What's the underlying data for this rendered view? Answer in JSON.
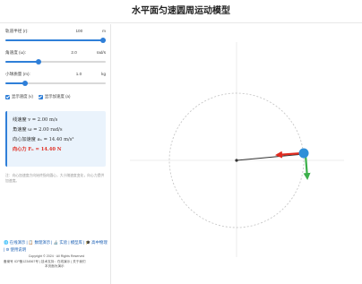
{
  "title": "水平面匀速圆周运动模型",
  "controls": [
    {
      "label": "轨道半径 (r):",
      "value": "100",
      "unit": "m",
      "fraction": 1.0
    },
    {
      "label": "角速度 (ω):",
      "value": "2.0",
      "unit": "rad/s",
      "fraction": 0.33
    },
    {
      "label": "小球质量 (m):",
      "value": "1.0",
      "unit": "kg",
      "fraction": 0.2
    }
  ],
  "checkboxes": [
    {
      "label": "显示速度 (v)",
      "checked": true
    },
    {
      "label": "显示加速度 (a)",
      "checked": true
    }
  ],
  "info": {
    "linear_velocity": "线速度   v = 2.00 m/s",
    "angular_velocity": "角速度   ω = 2.00 rad/s",
    "centripetal_accel": "向心加速度  aₙ = 14.40 m/s²",
    "centripetal_force": "向心力   Fₙ = 14.40 N"
  },
  "note": "注：向心加速度方向始终指向圆心，大小随速度变化，向心力提供加速度。",
  "footer": {
    "links": "🌐 在线演示 | 📋 数理演示 | 🔬 实验 | 模型库 | 🎓 高中物理 | ⚙ 使用说明",
    "copyright": "Copyright © 2024 · All Rights Reserved",
    "icp": "备案号 ICP备1234567号 | 技术支持：在线演示 | 关于我们",
    "misc": "本页面为演示"
  },
  "colors": {
    "accent": "#2f7fd8",
    "velocity": "#3cb04a",
    "acceleration": "#e02b20",
    "ball": "#2f8fd8"
  }
}
